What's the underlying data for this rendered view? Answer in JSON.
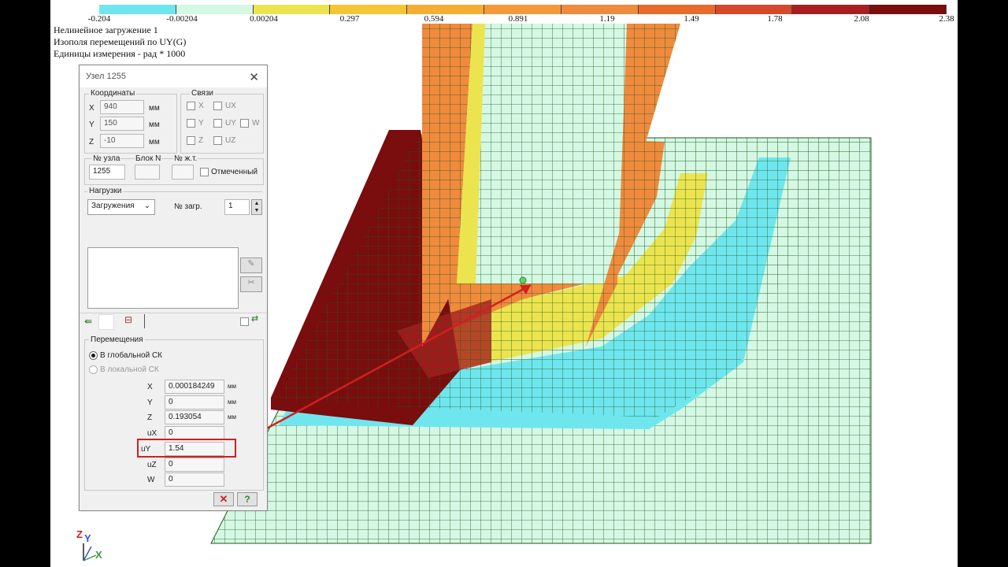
{
  "legend": {
    "colors": [
      "#6fe6ee",
      "#d4f8e3",
      "#ece44e",
      "#f6c535",
      "#f5ad34",
      "#f4993a",
      "#f08a3d",
      "#ea6a2a",
      "#d6482a",
      "#a81f1f",
      "#7a0d0d"
    ],
    "ticks": [
      "-0.204",
      "-0.00204",
      "0.00204",
      "0.297",
      "0.594",
      "0.891",
      "1.19",
      "1.49",
      "1.78",
      "2.08",
      "2.38"
    ]
  },
  "info": {
    "line1": "Нелинейное загружение 1",
    "line2": "Изополя  перемещений по UY(G)",
    "line3": "Единицы измерения - рад * 1000"
  },
  "dialog": {
    "title": "Узел 1255",
    "coords": {
      "label": "Координаты",
      "x_label": "X",
      "x_value": "940",
      "y_label": "Y",
      "y_value": "150",
      "z_label": "Z",
      "z_value": "-10",
      "unit": "мм"
    },
    "constraints": {
      "label": "Связи",
      "items": [
        "X",
        "UX",
        "Y",
        "UY",
        "W",
        "Z",
        "UZ"
      ]
    },
    "node": {
      "node_label": "№ узла",
      "node_value": "1255",
      "block_label": "Блок N",
      "block_value": "",
      "stiff_label": "№ ж.т.",
      "stiff_value": "",
      "marked_label": "Отмеченный"
    },
    "loads": {
      "label": "Нагрузки",
      "dropdown": "Загружения",
      "load_no_label": "№ загр.",
      "load_no_value": "1"
    },
    "displacements": {
      "label": "Перемещения",
      "global": "В глобальной СК",
      "local": "В локальной СК",
      "rows": [
        {
          "label": "X",
          "value": "0.000184249",
          "unit": "мм"
        },
        {
          "label": "Y",
          "value": "0",
          "unit": "мм"
        },
        {
          "label": "Z",
          "value": "0.193054",
          "unit": "мм"
        },
        {
          "label": "uX",
          "value": "0",
          "unit": ""
        },
        {
          "label": "uY",
          "value": "1.54",
          "unit": ""
        },
        {
          "label": "uZ",
          "value": "0",
          "unit": ""
        },
        {
          "label": "W",
          "value": "0",
          "unit": ""
        }
      ]
    },
    "close_symbol": "✕",
    "help_symbol": "?"
  },
  "axes": {
    "z": "Z",
    "y": "Y",
    "x": "X"
  },
  "colors": {
    "red": "#d21f1f",
    "mesh_green": "#d4f8e3",
    "cyan": "#6fe6ee"
  }
}
